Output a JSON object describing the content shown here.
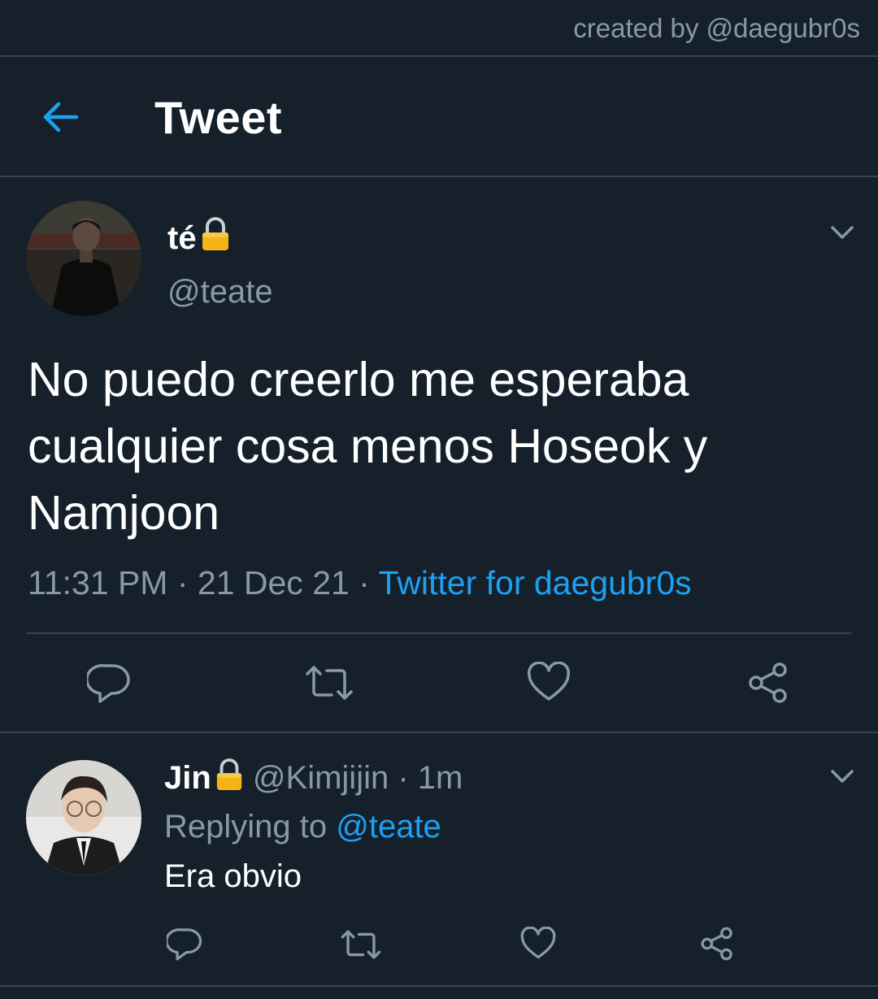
{
  "watermark": "created by @daegubr0s",
  "header": {
    "title": "Tweet",
    "back_icon": "arrow-left-icon"
  },
  "tweet": {
    "display_name": "té",
    "handle": "@teate",
    "text": "No puedo creerlo me esperaba cualquier cosa menos Hoseok y Namjoon",
    "time": "11:31 PM",
    "sep1": " · ",
    "date": "21 Dec 21",
    "sep2": " · ",
    "source": "Twitter for daegubr0s"
  },
  "reply": {
    "display_name": "Jin",
    "handle": "@Kimjijin",
    "sep": " · ",
    "age": "1m",
    "replying_prefix": "Replying to ",
    "replying_to": "@teate",
    "text": "Era obvio"
  },
  "colors": {
    "background": "#15202b",
    "divider": "#38444d",
    "secondary_text": "#8899a6",
    "accent": "#1da1f2",
    "lock": "#f5b316"
  },
  "icons": [
    "reply-icon",
    "retweet-icon",
    "like-icon",
    "share-icon",
    "lock-icon",
    "chevron-down-icon"
  ]
}
